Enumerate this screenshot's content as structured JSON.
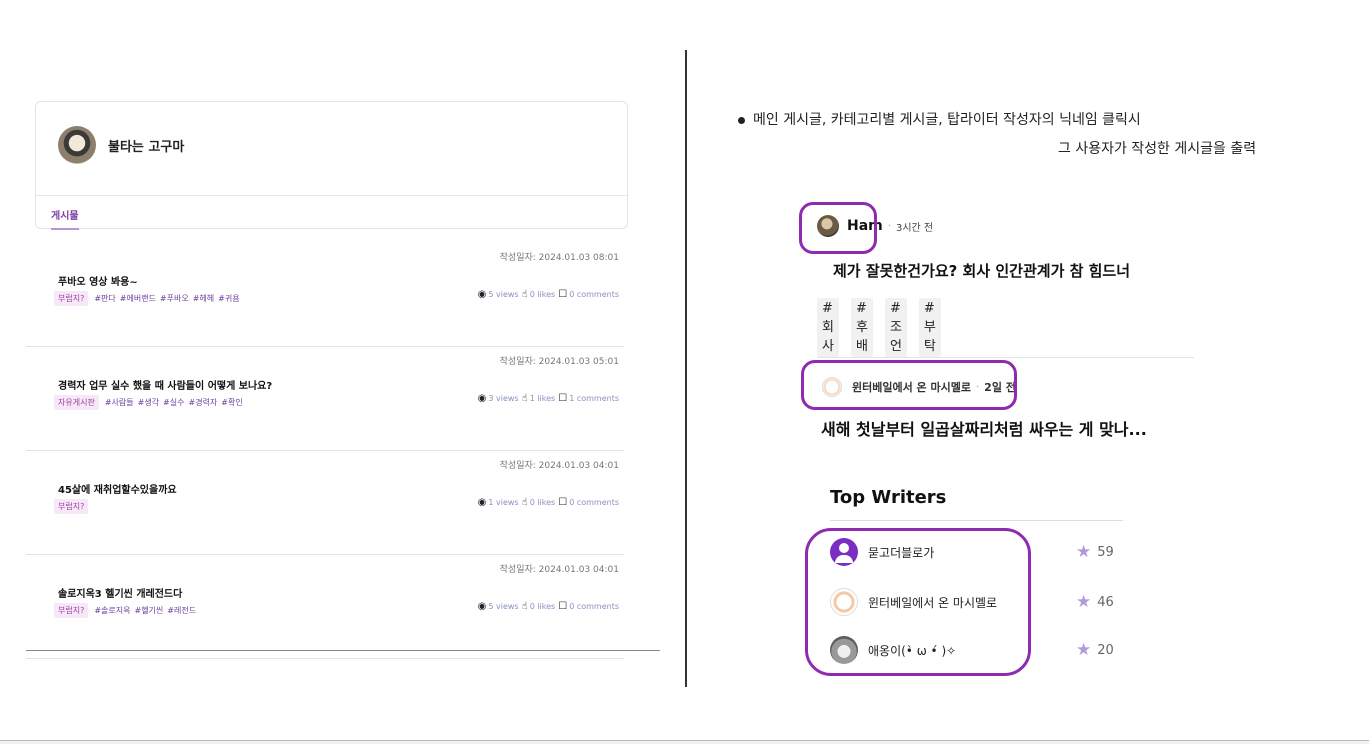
{
  "left": {
    "profile": {
      "name": "불타는 고구마"
    },
    "tab_label": "게시물",
    "posts": [
      {
        "date": "작성일자: 2024.01.03 08:01",
        "title": "푸바오 영상 봐용~",
        "category": "부럽지?",
        "tags": [
          "#판다",
          "#에버랜드",
          "#푸바오",
          "#헤헤",
          "#귀욤"
        ],
        "views": "5 views",
        "likes": "0 likes",
        "comments": "0 comments"
      },
      {
        "date": "작성일자: 2024.01.03 05:01",
        "title": "경력자 업무 실수 했을 때 사람들이 어떻게 보나요?",
        "category": "자유게시판",
        "tags": [
          "#사람들",
          "#생각",
          "#실수",
          "#경력자",
          "#확인"
        ],
        "views": "3 views",
        "likes": "1 likes",
        "comments": "1 comments"
      },
      {
        "date": "작성일자: 2024.01.03 04:01",
        "title": "45살에 재취업할수있을까요",
        "category": "부럽지?",
        "tags": [],
        "views": "1 views",
        "likes": "0 likes",
        "comments": "0 comments"
      },
      {
        "date": "작성일자: 2024.01.03 04:01",
        "title": "솔로지옥3 헬기씬 개레전드다",
        "category": "부럽지?",
        "tags": [
          "#솔로지옥",
          "#헬기씬",
          "#레전드"
        ],
        "views": "5 views",
        "likes": "0 likes",
        "comments": "0 comments"
      }
    ]
  },
  "right": {
    "note_line1": "메인 게시글, 카테고리별 게시글, 탑라이터 작성자의 닉네임 클릭시",
    "note_line2": "그 사용자가 작성한 게시글을 출력",
    "feed1": {
      "author": "Ham",
      "dot": "·",
      "time": "3시간 전",
      "title": "제가 잘못한건가요? 회사 인간관계가 참 힘드너",
      "hashtags": [
        "#회사",
        "#후배",
        "#조언",
        "#부탁"
      ]
    },
    "feed2": {
      "author": "윈터베일에서 온 마시멜로",
      "dot": "·",
      "time": "2일 전",
      "title": "새해 첫날부터 일곱살짜리처럼 싸우는 게 맞나..."
    },
    "top_writers": {
      "heading": "Top Writers",
      "items": [
        {
          "name": "묻고더블로가",
          "score": "59"
        },
        {
          "name": "윈터베일에서 온 마시멜로",
          "score": "46"
        },
        {
          "name": "애옹이(•̀ ω •́ )✧",
          "score": "20"
        }
      ]
    }
  },
  "icons": {
    "views": "eye-icon",
    "likes": "thumbs-up-icon",
    "comments": "comment-icon",
    "star": "star-icon"
  },
  "colors": {
    "accent": "#8e2bb0",
    "tab": "#7b3fa3",
    "category_bg": "#f6e8f6"
  }
}
